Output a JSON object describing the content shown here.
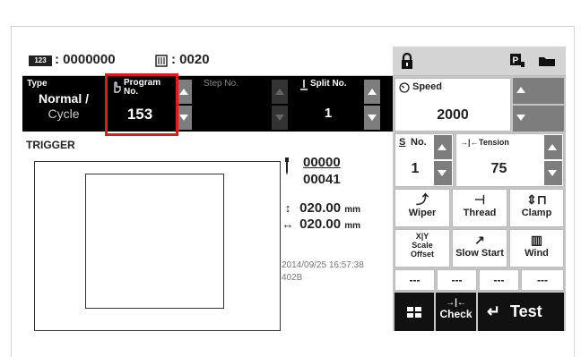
{
  "status_bar": {
    "counter_icon_label": "123",
    "counter_value": ": 0000000",
    "bobbin_value": ": 0020",
    "icons": [
      "lock-icon",
      "p-icon",
      "folder-icon"
    ]
  },
  "params": {
    "type_label": "Type",
    "type_value_line1": "Normal /",
    "type_value_line2": "Cycle",
    "program_label_line1": "Program",
    "program_label_line2": "No.",
    "program_value": "153",
    "step_label": "Step No.",
    "split_label": "Split No.",
    "split_value": "1"
  },
  "pattern": {
    "trigger_label": "TRIGGER",
    "stitch_current": "00000",
    "stitch_total": "00041",
    "dim_y": "020.00",
    "dim_x": "020.00",
    "unit": "mm",
    "datetime": "2014/09/25 16:57:38",
    "version": "402B"
  },
  "panel": {
    "speed_label": "Speed",
    "speed_value": "2000",
    "s_no_label": "No.",
    "s_no_value": "1",
    "tension_label": "Tension",
    "tension_value": "75",
    "wiper_label": "Wiper",
    "thread_label": "Thread",
    "clamp_label": "Clamp",
    "scale_line1": "Scale",
    "scale_line2": "Offset",
    "slow_start_label": "Slow Start",
    "wind_label": "Wind",
    "dash_1": "---",
    "dash_2": "---",
    "dash_3": "---",
    "dash_4": "---",
    "check_label": "Check",
    "test_label": "Test"
  }
}
